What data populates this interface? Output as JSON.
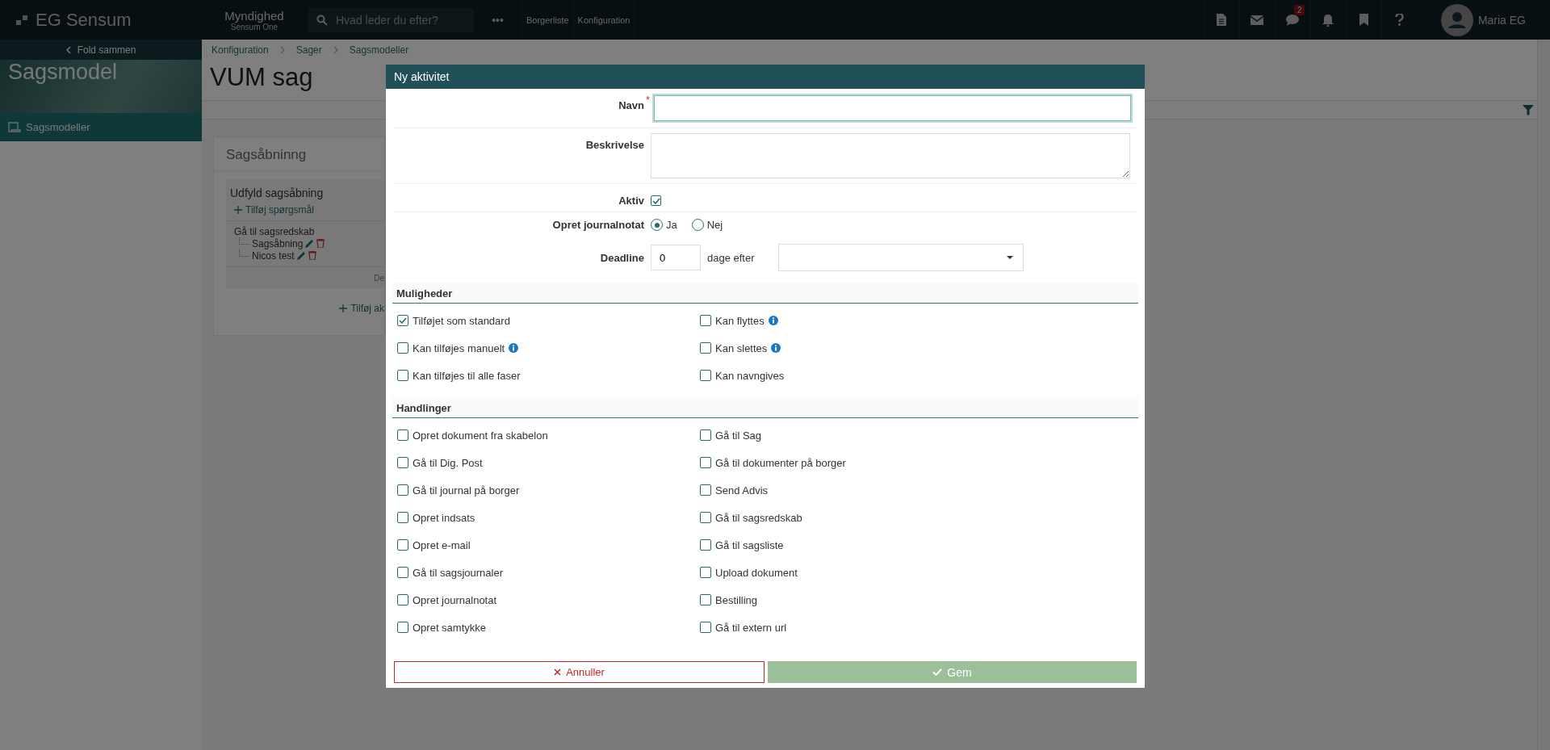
{
  "topbar": {
    "brand": "EG Sensum",
    "context_title": "Myndighed",
    "context_subtitle": "Sensum One",
    "search": {
      "placeholder": "Hvad leder du efter?"
    },
    "more": "•••",
    "nav": [
      "Borgerliste",
      "Konfiguration"
    ],
    "chat_badge": "2",
    "user": "Maria EG"
  },
  "sidebar": {
    "collapse": "Fold sammen",
    "title": "Sagsmodel",
    "items": [
      {
        "label": "Sagsmodeller",
        "selected": true
      }
    ]
  },
  "main": {
    "breadcrumb": [
      "Konfiguration",
      "Sager",
      "Sagsmodeller"
    ],
    "title": "VUM sag",
    "card": {
      "title": "Sagsåbninng",
      "group": "Udfyld sagsåbning",
      "add_question": "Tilføj spørgsmål",
      "tree": {
        "label": "Gå til sagsredskab",
        "children": [
          {
            "label": "Sagsåbning"
          },
          {
            "label": "Nicos test"
          }
        ]
      },
      "footer_text": "De",
      "add_activity": "Tilføj ak"
    }
  },
  "modal": {
    "title": "Ny aktivitet",
    "name": {
      "label": "Navn",
      "required_mark": "*"
    },
    "description": {
      "label": "Beskrivelse"
    },
    "active": {
      "label": "Aktiv",
      "checked": true
    },
    "journal": {
      "label": "Opret journalnotat",
      "options": [
        {
          "label": "Ja",
          "selected": true
        },
        {
          "label": "Nej",
          "selected": false
        }
      ]
    },
    "deadline": {
      "label": "Deadline",
      "value": "0",
      "unit": "dage efter"
    },
    "sections": [
      {
        "title": "Muligheder",
        "items": [
          {
            "label": "Tilføjet som standard",
            "checked": true,
            "info": false
          },
          {
            "label": "Kan flyttes",
            "checked": false,
            "info": true
          },
          {
            "label": "Kan tilføjes manuelt",
            "checked": false,
            "info": true
          },
          {
            "label": "Kan slettes",
            "checked": false,
            "info": true
          },
          {
            "label": "Kan tilføjes til alle faser",
            "checked": false,
            "info": false
          },
          {
            "label": "Kan navngives",
            "checked": false,
            "info": false
          }
        ]
      },
      {
        "title": "Handlinger",
        "items": [
          {
            "label": "Opret dokument fra skabelon",
            "checked": false,
            "info": false
          },
          {
            "label": "Gå til Sag",
            "checked": false,
            "info": false
          },
          {
            "label": "Gå til Dig. Post",
            "checked": false,
            "info": false
          },
          {
            "label": "Gå til dokumenter på borger",
            "checked": false,
            "info": false
          },
          {
            "label": "Gå til journal på borger",
            "checked": false,
            "info": false
          },
          {
            "label": "Send Advis",
            "checked": false,
            "info": false
          },
          {
            "label": "Opret indsats",
            "checked": false,
            "info": false
          },
          {
            "label": "Gå til sagsredskab",
            "checked": false,
            "info": false
          },
          {
            "label": "Opret e-mail",
            "checked": false,
            "info": false
          },
          {
            "label": "Gå til sagsliste",
            "checked": false,
            "info": false
          },
          {
            "label": "Gå til sagsjournaler",
            "checked": false,
            "info": false
          },
          {
            "label": "Upload dokument",
            "checked": false,
            "info": false
          },
          {
            "label": "Opret journalnotat",
            "checked": false,
            "info": false
          },
          {
            "label": "Bestilling",
            "checked": false,
            "info": false
          },
          {
            "label": "Opret samtykke",
            "checked": false,
            "info": false
          },
          {
            "label": "Gå til extern url",
            "checked": false,
            "info": false
          }
        ]
      }
    ],
    "cancel": "Annuller",
    "save": "Gem"
  }
}
